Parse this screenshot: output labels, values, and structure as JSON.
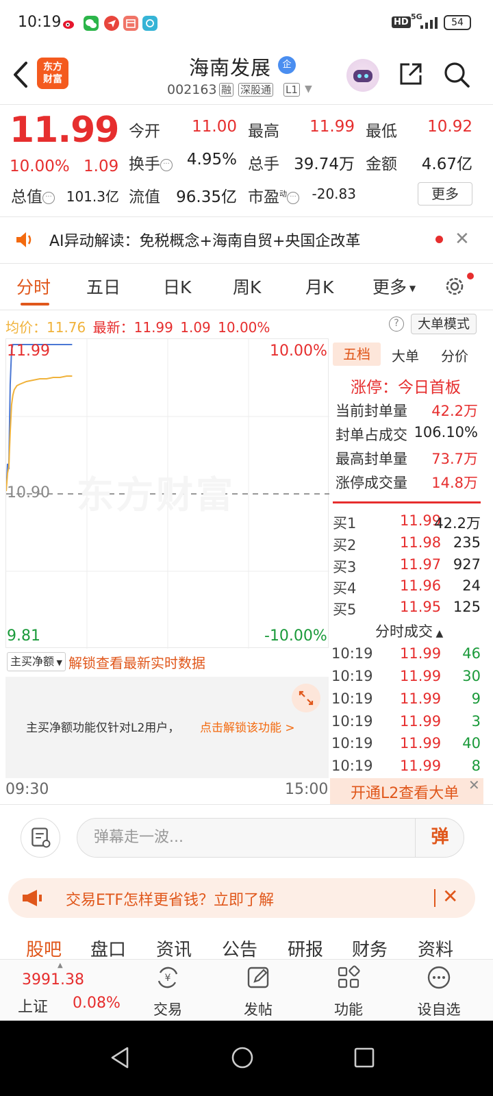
{
  "status_bar": {
    "time": "10:19",
    "network": "5G",
    "hd": "HD",
    "battery": "54"
  },
  "header": {
    "logo_line1": "东方",
    "logo_line2": "财富",
    "stock_name": "海南发展",
    "badge": "企",
    "code": "002163",
    "tags": [
      "融",
      "深股通",
      "L1"
    ]
  },
  "quote": {
    "price": "11.99",
    "change_pct": "10.00%",
    "change_amt": "1.09",
    "rows": [
      [
        {
          "label": "今开",
          "value": "11.00",
          "color": "red"
        },
        {
          "label": "最高",
          "value": "11.99",
          "color": "red"
        },
        {
          "label": "最低",
          "value": "10.92",
          "color": "red"
        }
      ],
      [
        {
          "label": "换手",
          "value": "4.95%",
          "color": "dark"
        },
        {
          "label": "总手",
          "value": "39.74万",
          "color": "dark"
        },
        {
          "label": "金额",
          "value": "4.67亿",
          "color": "dark"
        }
      ],
      [
        {
          "label": "总值",
          "value": "101.3亿",
          "color": "dark"
        },
        {
          "label": "流值",
          "value": "96.35亿",
          "color": "dark"
        },
        {
          "label": "市盈",
          "value": "-20.83",
          "color": "dark"
        }
      ]
    ],
    "pe_superscript": "动",
    "more_label": "更多"
  },
  "ai_banner": {
    "text": "AI异动解读：免税概念+海南自贸+央国企改革"
  },
  "chart_tabs": [
    "分时",
    "五日",
    "日K",
    "周K",
    "月K",
    "更多"
  ],
  "summary": {
    "avg_label": "均价：",
    "avg_value": "11.76",
    "latest_label": "最新：",
    "latest_value": "11.99",
    "latest_chg": "1.09",
    "latest_pct": "10.00%",
    "mode_button": "大单模式"
  },
  "chart": {
    "high_price": "11.99",
    "high_pct": "10.00%",
    "pre_close": "10.90",
    "low_price": "9.81",
    "low_pct": "-10.00%",
    "watermark": "东方财富",
    "time_start": "09:30",
    "time_end": "15:00"
  },
  "chart_data": {
    "type": "line",
    "x": [
      "09:30",
      "09:31",
      "09:32",
      "09:33",
      "09:34",
      "09:35",
      "09:36",
      "09:38",
      "09:40",
      "09:45",
      "09:50",
      "09:55",
      "10:00",
      "10:05",
      "10:10",
      "10:15",
      "10:19"
    ],
    "series": [
      {
        "values": [
          10.92,
          11.12,
          11.08,
          11.7,
          11.95,
          11.99,
          11.99,
          11.99,
          11.99,
          11.99,
          11.99,
          11.99,
          11.99,
          11.99,
          11.99,
          11.99,
          11.99
        ],
        "color": "#4a77d4"
      },
      {
        "values": [
          10.92,
          11.05,
          11.1,
          11.35,
          11.55,
          11.62,
          11.66,
          11.69,
          11.7,
          11.72,
          11.73,
          11.74,
          11.74,
          11.75,
          11.75,
          11.76,
          11.76
        ],
        "color": "#f0b23a"
      }
    ],
    "ylim": [
      9.81,
      11.99
    ],
    "reference": 10.9,
    "x_range": [
      "09:30",
      "15:00"
    ]
  },
  "main_buy": {
    "select_label": "主买净额",
    "unlock_text": "解锁查看最新实时数据",
    "l2_text": "主买净额功能仅针对L2用户，",
    "l2_link": "点击解锁该功能 >"
  },
  "right_panel": {
    "tabs": [
      "五档",
      "大单",
      "分价"
    ],
    "limit_title": "涨停：今日首板",
    "seal": [
      {
        "label": "当前封单量",
        "value": "42.2万",
        "color": "red"
      },
      {
        "label": "封单占成交",
        "value": "106.10%",
        "color": "dark"
      },
      {
        "label": "最高封单量",
        "value": "73.7万",
        "color": "red"
      },
      {
        "label": "涨停成交量",
        "value": "14.8万",
        "color": "red"
      }
    ],
    "bids": [
      {
        "label": "买1",
        "price": "11.99",
        "vol": "42.2万"
      },
      {
        "label": "买2",
        "price": "11.98",
        "vol": "235"
      },
      {
        "label": "买3",
        "price": "11.97",
        "vol": "927"
      },
      {
        "label": "买4",
        "price": "11.96",
        "vol": "24"
      },
      {
        "label": "买5",
        "price": "11.95",
        "vol": "125"
      }
    ],
    "ticks_title": "分时成交",
    "ticks": [
      {
        "time": "10:19",
        "price": "11.99",
        "vol": "46"
      },
      {
        "time": "10:19",
        "price": "11.99",
        "vol": "30"
      },
      {
        "time": "10:19",
        "price": "11.99",
        "vol": "9"
      },
      {
        "time": "10:19",
        "price": "11.99",
        "vol": "3"
      },
      {
        "time": "10:19",
        "price": "11.99",
        "vol": "40"
      },
      {
        "time": "10:19",
        "price": "11.99",
        "vol": "8"
      }
    ],
    "l2_bigorder": "开通L2查看大单"
  },
  "danmaku": {
    "placeholder": "弹幕走一波...",
    "send": "弹"
  },
  "etf_banner": {
    "text": "交易ETF怎样更省钱？立即了解"
  },
  "bottom_tabs": [
    "股吧",
    "盘口",
    "资讯",
    "公告",
    "研报",
    "财务",
    "资料"
  ],
  "bottom_nav": {
    "index_value": "3991.38",
    "index_name": "上证",
    "index_pct": "0.08%",
    "items": [
      "交易",
      "发帖",
      "功能",
      "设自选"
    ]
  }
}
